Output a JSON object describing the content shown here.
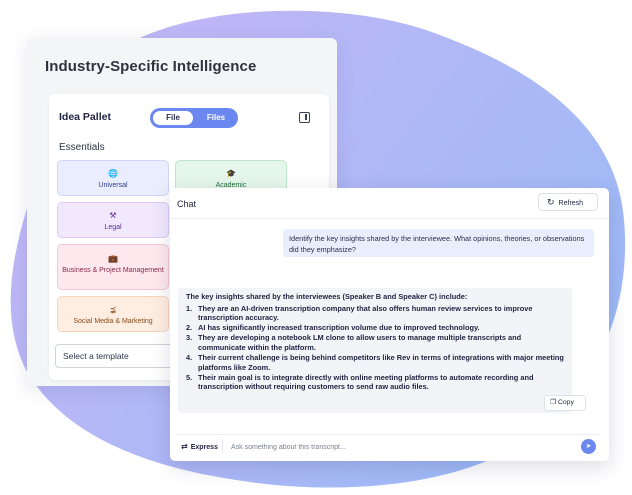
{
  "back_card": {
    "title": "Industry-Specific Intelligence"
  },
  "pallet": {
    "title": "Idea Pallet",
    "toggle": {
      "active": "File",
      "inactive": "Files"
    },
    "section_label": "Essentials",
    "tiles": [
      {
        "icon": "globe-icon",
        "label": "Universal"
      },
      {
        "icon": "graduation-cap-icon",
        "label": "Academic"
      },
      {
        "icon": "gavel-icon",
        "label": "Legal"
      },
      {
        "icon": "briefcase-icon",
        "label": "Business & Project Management"
      },
      {
        "icon": "share-icon",
        "label": "Social Media & Marketing"
      }
    ],
    "select_placeholder": "Select a template"
  },
  "chat": {
    "title": "Chat",
    "refresh_label": "Refresh",
    "user_message": "Identify the key insights shared by the interviewee. What opinions, theories, or observations did they emphasize?",
    "bot_intro": "The key insights shared by the interviewees (Speaker B and Speaker C) include:",
    "bot_points": [
      {
        "num": "1.",
        "text": "They are an AI-driven transcription company that also offers human review services to improve transcription accuracy."
      },
      {
        "num": "2.",
        "text": "AI has significantly increased transcription volume due to improved technology."
      },
      {
        "num": "3.",
        "text": "They are developing a notebook LM clone to allow users to manage multiple transcripts and communicate within the platform."
      },
      {
        "num": "4.",
        "text": "Their current challenge is being behind competitors like Rev in terms of integrations with major meeting platforms like Zoom."
      },
      {
        "num": "5.",
        "text": "Their main goal is to integrate directly with online meeting platforms to automate recording and transcription without requiring customers to send raw audio files."
      }
    ],
    "copy_label": "Copy",
    "mode_label": "Express",
    "input_placeholder": "Ask something about this transcript..."
  },
  "colors": {
    "accent": "#6b87f0",
    "blob_start": "#c9b6f5",
    "blob_end": "#9fb9f7"
  }
}
